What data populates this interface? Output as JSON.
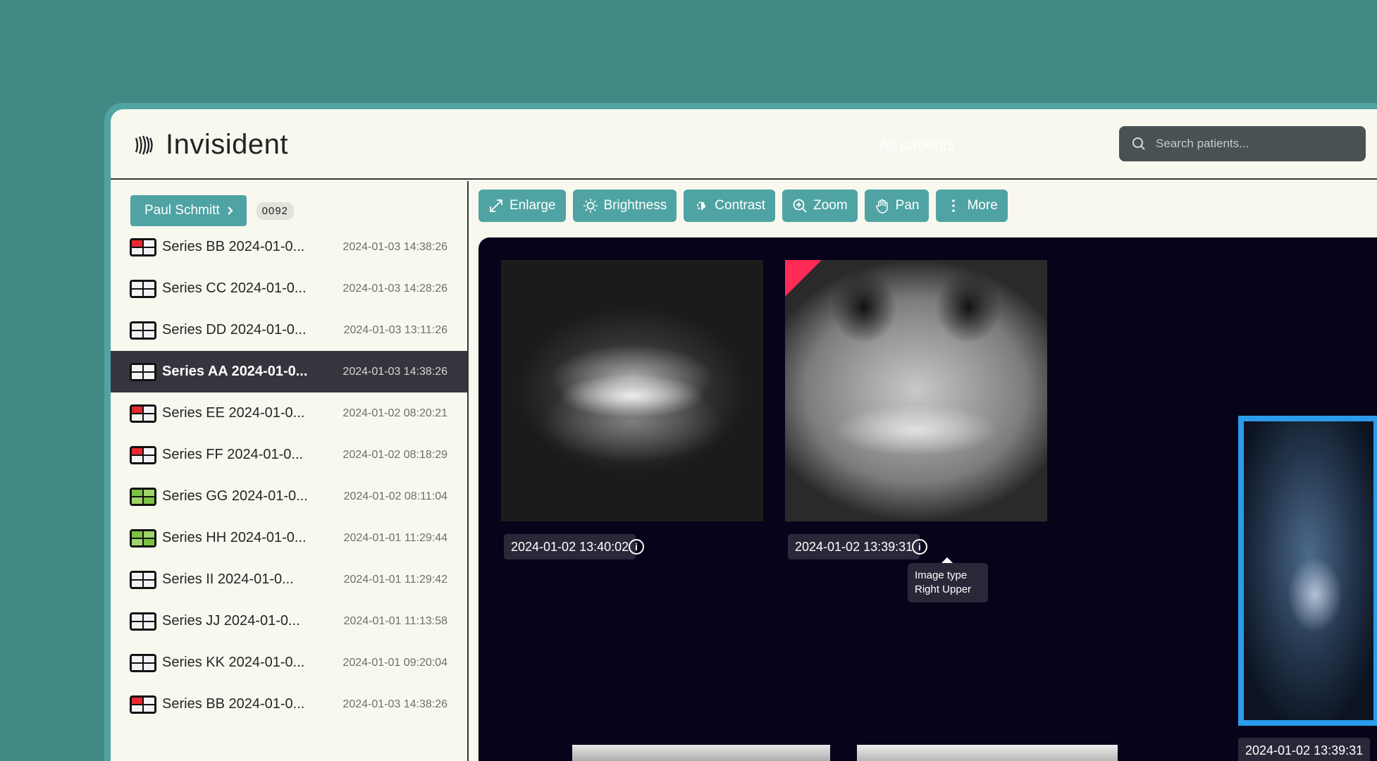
{
  "header": {
    "app_name": "Invisident",
    "center_title": "All patients",
    "search_placeholder": "Search patients..."
  },
  "patient": {
    "name": "Paul Schmitt",
    "id": "0092"
  },
  "toolbar": [
    {
      "label": "Enlarge",
      "icon": "enlarge-icon"
    },
    {
      "label": "Brightness",
      "icon": "brightness-icon"
    },
    {
      "label": "Contrast",
      "icon": "contrast-icon"
    },
    {
      "label": "Zoom",
      "icon": "zoom-icon"
    },
    {
      "label": "Pan",
      "icon": "pan-icon"
    },
    {
      "label": "More",
      "icon": "more-icon"
    }
  ],
  "series": [
    {
      "name": "Series BB 2024-01-0...",
      "time": "2024-01-03 14:38:26",
      "icon": "red",
      "active": false
    },
    {
      "name": "Series CC 2024-01-0...",
      "time": "2024-01-03 14:28:26",
      "icon": "dark",
      "active": false
    },
    {
      "name": "Series DD 2024-01-0...",
      "time": "2024-01-03 13:11:26",
      "icon": "dark",
      "active": false
    },
    {
      "name": "Series AA 2024-01-0...",
      "time": "2024-01-03 14:38:26",
      "icon": "dark",
      "active": true
    },
    {
      "name": "Series EE 2024-01-0...",
      "time": "2024-01-02 08:20:21",
      "icon": "red",
      "active": false
    },
    {
      "name": "Series FF 2024-01-0...",
      "time": "2024-01-02 08:18:29",
      "icon": "red",
      "active": false
    },
    {
      "name": "Series GG 2024-01-0...",
      "time": "2024-01-02 08:11:04",
      "icon": "green",
      "active": false
    },
    {
      "name": "Series HH 2024-01-0...",
      "time": "2024-01-01 11:29:44",
      "icon": "green",
      "active": false
    },
    {
      "name": "Series II 2024-01-0...",
      "time": "2024-01-01 11:29:42",
      "icon": "dark",
      "active": false
    },
    {
      "name": "Series JJ 2024-01-0...",
      "time": "2024-01-01 11:13:58",
      "icon": "dark",
      "active": false
    },
    {
      "name": "Series KK 2024-01-0...",
      "time": "2024-01-01 09:20:04",
      "icon": "dark",
      "active": false
    },
    {
      "name": "Series BB 2024-01-0...",
      "time": "2024-01-03 14:38:26",
      "icon": "red",
      "active": false
    }
  ],
  "images": [
    {
      "timestamp": "2024-01-02 13:40:02"
    },
    {
      "timestamp": "2024-01-02 13:39:31"
    },
    {
      "timestamp": "2024-01-02 13:39:31"
    }
  ],
  "tooltip": {
    "line1": "Image type",
    "line2": "Right Upper"
  },
  "colors": {
    "accent": "#4fa3a3",
    "background": "#418985",
    "viewer": "#07031a",
    "selected_border": "#2b9bea",
    "flag": "#ff2a55"
  }
}
